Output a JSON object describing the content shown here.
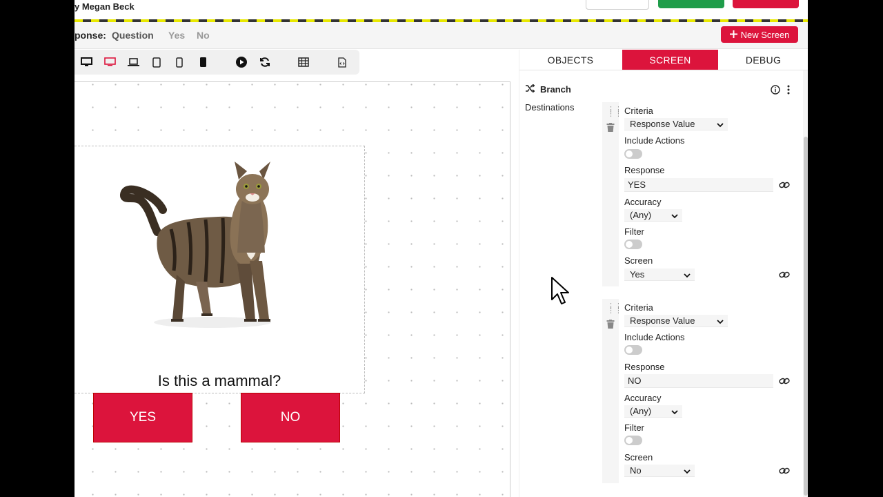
{
  "user": {
    "name": "y Megan Beck"
  },
  "response_bar": {
    "label": "ponse:",
    "question_label": "Question",
    "options": [
      "Yes",
      "No"
    ],
    "new_screen_label": "New Screen"
  },
  "device_toolbar": {
    "icons": [
      "desktop-icon",
      "monitor-icon",
      "laptop-icon",
      "tablet-icon",
      "phone-icon",
      "phone-dark-icon",
      "play-icon",
      "refresh-icon",
      "grid-icon",
      "code-file-icon"
    ]
  },
  "canvas": {
    "question": "Is this a mammal?",
    "answers": [
      "YES",
      "NO"
    ],
    "image": "cat-image"
  },
  "panel": {
    "tabs": [
      "OBJECTS",
      "SCREEN",
      "DEBUG"
    ],
    "active_tab": "SCREEN",
    "branch_title": "Branch",
    "destinations_label": "Destinations",
    "criteria": [
      {
        "criteria_label": "Criteria",
        "criteria_value": "Response Value",
        "include_actions_label": "Include Actions",
        "response_label": "Response",
        "response_value": "YES",
        "accuracy_label": "Accuracy",
        "accuracy_value": "(Any)",
        "filter_label": "Filter",
        "screen_label": "Screen",
        "screen_value": "Yes"
      },
      {
        "criteria_label": "Criteria",
        "criteria_value": "Response Value",
        "include_actions_label": "Include Actions",
        "response_label": "Response",
        "response_value": "NO",
        "accuracy_label": "Accuracy",
        "accuracy_value": "(Any)",
        "filter_label": "Filter",
        "screen_label": "Screen",
        "screen_value": "No"
      }
    ]
  },
  "colors": {
    "accent": "#dc143c",
    "success": "#1f9d4a"
  }
}
